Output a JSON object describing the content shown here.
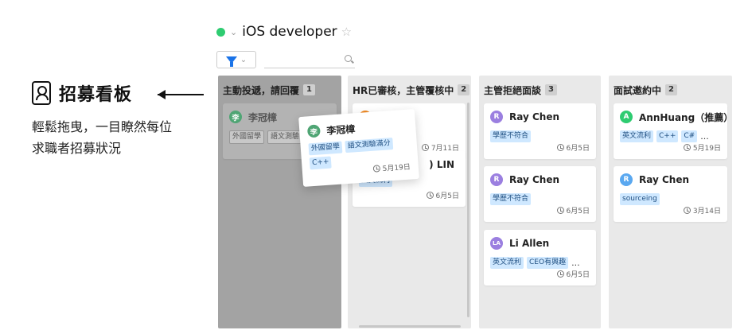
{
  "promo": {
    "title": "招募看板",
    "description": "輕鬆拖曳，一目瞭然每位求職者招募狀況"
  },
  "board": {
    "title": "iOS developer",
    "status_color": "#2ecc71",
    "search_placeholder": ""
  },
  "colors": {
    "accent": "#1a73e8",
    "tag_bg": "#cfe8ff",
    "avatar_green": "#2ecc71",
    "avatar_purple": "#9b7fe0",
    "avatar_blue": "#5aa8f0",
    "avatar_orange": "#f08a24",
    "avatar_gray": "#4fa574"
  },
  "columns": [
    {
      "title": "主動投遞，請回覆",
      "count": "1",
      "cards": [
        {
          "avatar": "李",
          "name": "李冠樟",
          "tags": [
            "外國留學",
            "語文測驗"
          ],
          "date": ""
        }
      ]
    },
    {
      "title": "HR已審核，主管覆核中",
      "count": "2",
      "cards": [
        {
          "avatar": "",
          "name": "",
          "tags": [],
          "date": "7月11日"
        },
        {
          "avatar": "",
          "name": ") LIN",
          "tags": [
            "英文流利"
          ],
          "date": "6月5日"
        }
      ]
    },
    {
      "title": "主管拒絕面談",
      "count": "3",
      "cards": [
        {
          "avatar": "R",
          "name": "Ray Chen",
          "tags": [
            "學歷不符合"
          ],
          "date": "6月5日"
        },
        {
          "avatar": "R",
          "name": "Ray Chen",
          "tags": [
            "學歷不符合"
          ],
          "date": "6月5日"
        },
        {
          "avatar": "LA",
          "name": "Li Allen",
          "tags": [
            "英文流利",
            "CEO有興趣"
          ],
          "more": "...",
          "date": "6月5日"
        }
      ]
    },
    {
      "title": "面試邀約中",
      "count": "2",
      "cards": [
        {
          "avatar": "A",
          "name": "AnnHuang（推薦）",
          "tags": [
            "英文流利",
            "C++",
            "C#"
          ],
          "more": "...",
          "date": "5月19日"
        },
        {
          "avatar": "R",
          "name": "Ray Chen",
          "tags": [
            "sourceing"
          ],
          "date": "3月14日"
        }
      ]
    }
  ],
  "dragged_card": {
    "avatar": "李",
    "name": "李冠樟",
    "tags": [
      "外國留學",
      "語文測驗滿分",
      "C++"
    ],
    "date": "5月19日"
  }
}
